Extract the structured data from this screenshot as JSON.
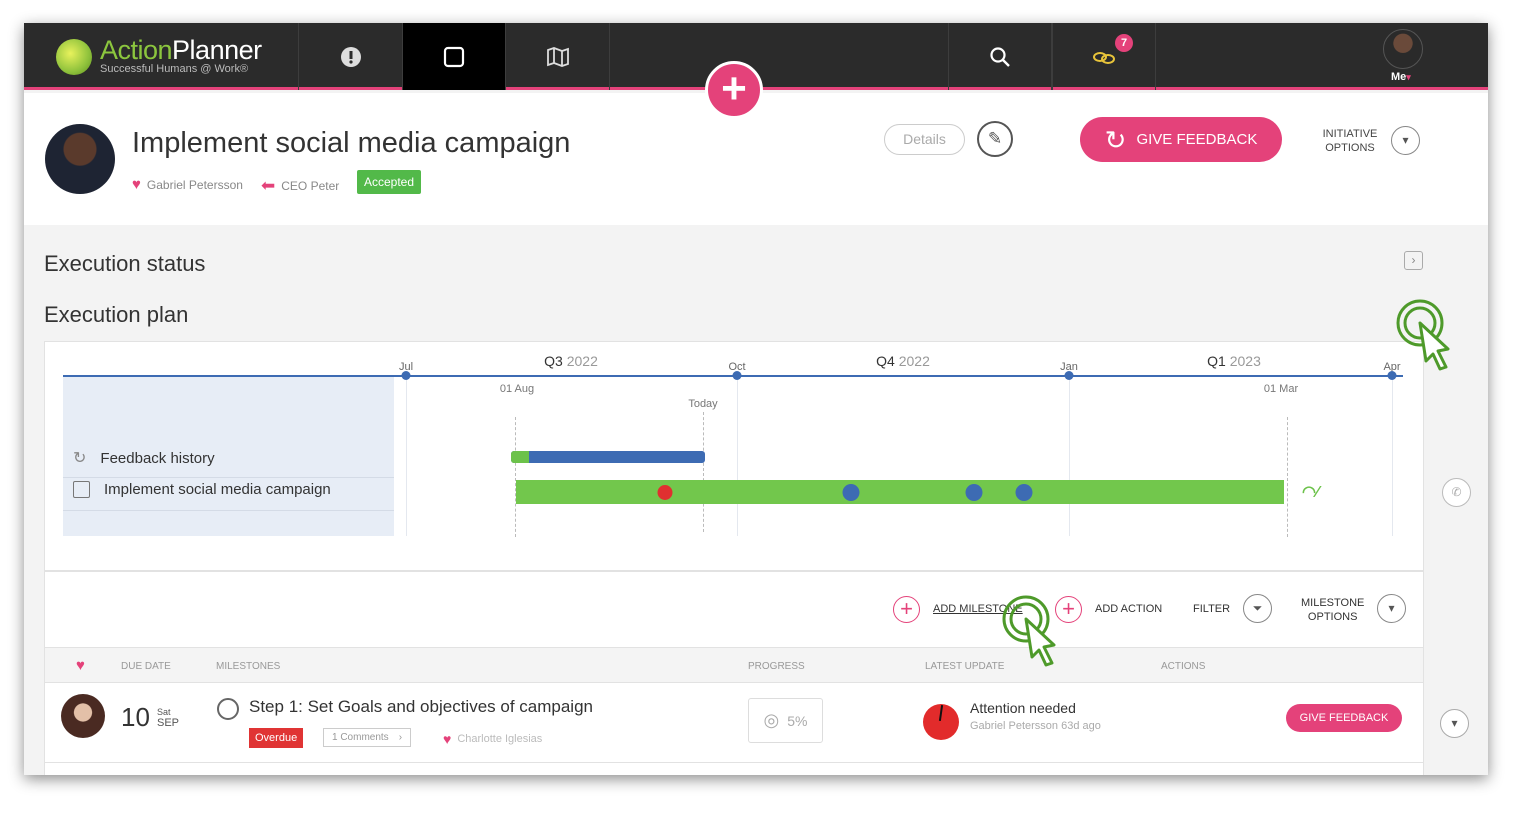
{
  "app": {
    "logo_action": "Action",
    "logo_planner": "Planner",
    "tagline": "Successful Humans @ Work®",
    "notifications_count": "7",
    "me_label": "Me"
  },
  "initiative": {
    "title": "Implement social media campaign",
    "owner": "Gabriel Petersson",
    "sponsor": "CEO Peter",
    "status": "Accepted",
    "details_label": "Details",
    "give_feedback_label": "GIVE FEEDBACK",
    "options_label_1": "INITIATIVE",
    "options_label_2": "OPTIONS"
  },
  "sections": {
    "execution_status": "Execution status",
    "execution_plan": "Execution plan"
  },
  "gantt": {
    "rows": [
      {
        "label": "Feedback history",
        "icon": "refresh-icon"
      },
      {
        "label": "Implement social media campaign",
        "icon": "checkbox-icon"
      }
    ],
    "months": [
      {
        "label": "Jul"
      },
      {
        "label": "Oct"
      },
      {
        "label": "Jan"
      },
      {
        "label": "Apr"
      }
    ],
    "quarters": [
      {
        "q": "Q3",
        "year": "2022"
      },
      {
        "q": "Q4",
        "year": "2022"
      },
      {
        "q": "Q1",
        "year": "2023"
      }
    ],
    "date_labels": {
      "aug": "01 Aug",
      "today": "Today",
      "mar": "01 Mar"
    },
    "progress_fraction": 0.05
  },
  "toolbar": {
    "add_milestone": "ADD MILESTONE",
    "add_action": "ADD ACTION",
    "filter": "FILTER",
    "milestone_options_1": "MILESTONE",
    "milestone_options_2": "OPTIONS"
  },
  "table": {
    "headers": {
      "due_date": "DUE DATE",
      "milestones": "MILESTONES",
      "progress": "PROGRESS",
      "latest_update": "LATEST UPDATE",
      "actions": "ACTIONS"
    },
    "rows": [
      {
        "day": "10",
        "weekday": "Sat",
        "month": "SEP",
        "title": "Step 1: Set Goals and objectives of campaign",
        "overdue": "Overdue",
        "comments": "1 Comments",
        "assignee": "Charlotte Iglesias",
        "progress": "5%",
        "update_title": "Attention needed",
        "update_sub": "Gabriel Petersson 63d ago",
        "feedback": "GIVE FEEDBACK"
      }
    ]
  },
  "colors": {
    "accent": "#e4427a",
    "nav": "#2b2b2b",
    "timeline_blue": "#3d6bb3",
    "bar_green": "#72c74c",
    "overdue_red": "#e03434"
  }
}
